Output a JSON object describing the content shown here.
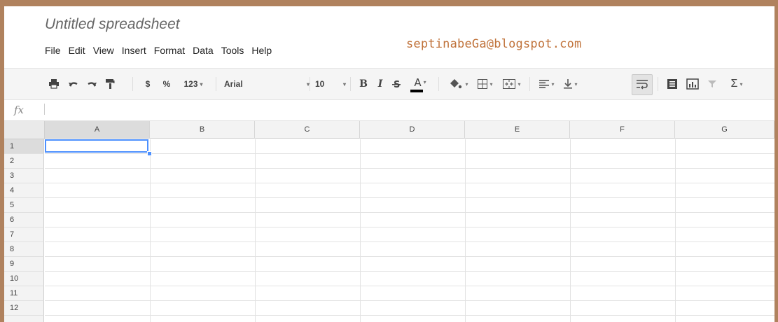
{
  "document": {
    "title": "Untitled spreadsheet"
  },
  "watermark": "septinabeGa@blogspot.com",
  "menu": [
    "File",
    "Edit",
    "View",
    "Insert",
    "Format",
    "Data",
    "Tools",
    "Help"
  ],
  "toolbar": {
    "currency": "$",
    "percent": "%",
    "number_format": "123",
    "font_family": "Arial",
    "font_size": "10",
    "bold": "B",
    "italic": "I",
    "text_color_letter": "A",
    "sum": "Σ"
  },
  "formula_bar": {
    "label": "fx",
    "value": ""
  },
  "columns": [
    "A",
    "B",
    "C",
    "D",
    "E",
    "F",
    "G"
  ],
  "rows": [
    "1",
    "2",
    "3",
    "4",
    "5",
    "6",
    "7",
    "8",
    "9",
    "10",
    "11",
    "12"
  ],
  "selection": {
    "cell": "A1"
  },
  "colors": {
    "frame": "#b0825e",
    "selection": "#4d90fe",
    "watermark": "#c0723a"
  }
}
